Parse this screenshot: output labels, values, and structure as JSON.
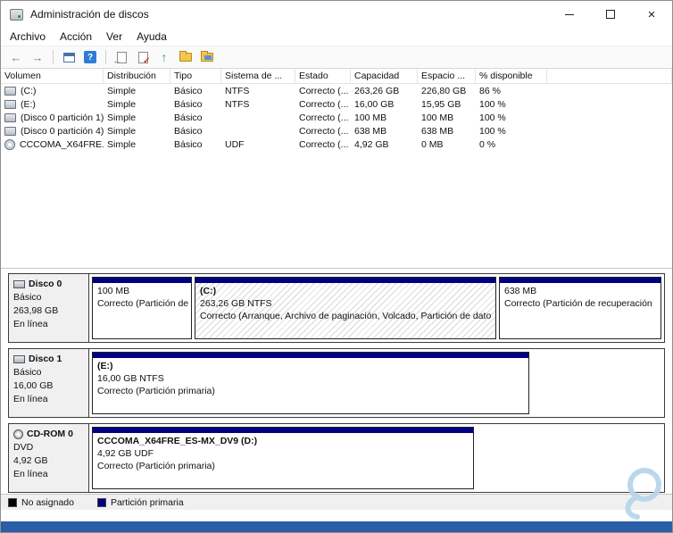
{
  "window": {
    "title": "Administración de discos"
  },
  "menu": {
    "items": [
      "Archivo",
      "Acción",
      "Ver",
      "Ayuda"
    ]
  },
  "toolbar": {
    "icons": [
      "back-icon",
      "forward-icon",
      "console-tree-icon",
      "help-icon",
      "properties-icon",
      "rescan-icon",
      "up-level-icon",
      "folder-icon",
      "folder-settings-icon"
    ]
  },
  "volume_table": {
    "columns": [
      "Volumen",
      "Distribución",
      "Tipo",
      "Sistema de ...",
      "Estado",
      "Capacidad",
      "Espacio ...",
      "% disponible"
    ],
    "rows": [
      {
        "volumen": "(C:)",
        "distribucion": "Simple",
        "tipo": "Básico",
        "sistema": "NTFS",
        "estado": "Correcto (...",
        "capacidad": "263,26 GB",
        "espacio": "226,80 GB",
        "disponible": "86 %"
      },
      {
        "volumen": "(E:)",
        "distribucion": "Simple",
        "tipo": "Básico",
        "sistema": "NTFS",
        "estado": "Correcto (...",
        "capacidad": "16,00 GB",
        "espacio": "15,95 GB",
        "disponible": "100 %"
      },
      {
        "volumen": "(Disco 0 partición 1)",
        "distribucion": "Simple",
        "tipo": "Básico",
        "sistema": "",
        "estado": "Correcto (...",
        "capacidad": "100 MB",
        "espacio": "100 MB",
        "disponible": "100 %"
      },
      {
        "volumen": "(Disco 0 partición 4)",
        "distribucion": "Simple",
        "tipo": "Básico",
        "sistema": "",
        "estado": "Correcto (...",
        "capacidad": "638 MB",
        "espacio": "638 MB",
        "disponible": "100 %"
      },
      {
        "volumen": "CCCOMA_X64FRE...",
        "distribucion": "Simple",
        "tipo": "Básico",
        "sistema": "UDF",
        "estado": "Correcto (...",
        "capacidad": "4,92 GB",
        "espacio": "0 MB",
        "disponible": "0 %"
      }
    ]
  },
  "disks": [
    {
      "name": "Disco 0",
      "type": "Básico",
      "size": "263,98 GB",
      "status": "En línea",
      "partitions": [
        {
          "line1": "100 MB",
          "line2": "Correcto (Partición de s"
        },
        {
          "title": "(C:)",
          "line1": "263,26 GB NTFS",
          "line2": "Correcto (Arranque, Archivo de paginación, Volcado, Partición de dato"
        },
        {
          "line1": "638 MB",
          "line2": "Correcto (Partición de recuperación"
        }
      ]
    },
    {
      "name": "Disco 1",
      "type": "Básico",
      "size": "16,00 GB",
      "status": "En línea",
      "partitions": [
        {
          "title": "(E:)",
          "line1": "16,00 GB NTFS",
          "line2": "Correcto (Partición primaria)"
        }
      ]
    },
    {
      "name": "CD-ROM 0",
      "type": "DVD",
      "size": "4,92 GB",
      "status": "En línea",
      "partitions": [
        {
          "title": "CCCOMA_X64FRE_ES-MX_DV9 (D:)",
          "line1": "4,92 GB UDF",
          "line2": "Correcto (Partición primaria)"
        }
      ]
    }
  ],
  "legend": {
    "items": [
      {
        "label": "No asignado",
        "color": "#000000"
      },
      {
        "label": "Partición primaria",
        "color": "#000082"
      }
    ]
  },
  "colors": {
    "partition_bar": "#000082",
    "footer_strip": "#2a5fa8"
  }
}
